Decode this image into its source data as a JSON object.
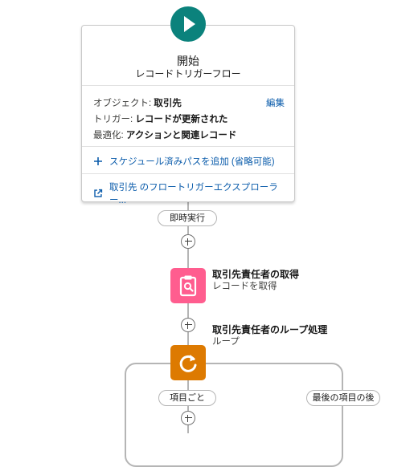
{
  "start": {
    "title": "開始",
    "subtitle": "レコードトリガーフロー",
    "object_label": "オブジェクト:",
    "object_value": "取引先",
    "edit_label": "編集",
    "trigger_label": "トリガー:",
    "trigger_value": "レコードが更新された",
    "optimize_label": "最適化:",
    "optimize_value": "アクションと関連レコード",
    "add_scheduled_path": "スケジュール済みパスを追加 (省略可能)",
    "explorer_link": "取引先 のフロートリガーエクスプローラー..."
  },
  "immediate_path_label": "即時実行",
  "get_records": {
    "label": "取引先責任者の取得",
    "type": "レコードを取得"
  },
  "loop": {
    "label": "取引先責任者のループ処理",
    "type": "ループ",
    "for_each_label": "項目ごと",
    "after_last_label": "最後の項目の後"
  },
  "colors": {
    "start": "#0b827c",
    "get_records": "#ff5d8f",
    "loop": "#dd7a01",
    "link": "#0b5cab",
    "connector": "#b5b5b5"
  }
}
